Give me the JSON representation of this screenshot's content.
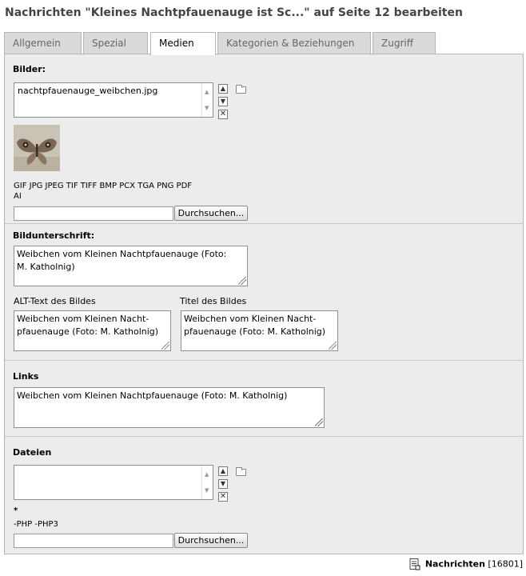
{
  "page": {
    "title": "Nachrichten \"Kleines Nachtpfauenauge ist Sc...\" auf Seite 12 bearbeiten"
  },
  "tabs": [
    {
      "label": "Allgemein"
    },
    {
      "label": "Spezial"
    },
    {
      "label": "Medien"
    },
    {
      "label": "Kategorien & Beziehungen"
    },
    {
      "label": "Zugriff"
    }
  ],
  "active_tab": "Medien",
  "images": {
    "label": "Bilder:",
    "files": [
      "nachtpfauenauge_weibchen.jpg"
    ],
    "allowed_types": "GIF JPG JPEG TIF TIFF BMP PCX TGA PNG PDF",
    "allowed_types_cont": "AI",
    "browse_label": "Durchsuchen..."
  },
  "caption": {
    "label": "Bildunterschrift:",
    "value_line1": "Weibchen vom Kleinen Nachtpfauenauge (Foto:",
    "value_line2": "M. Katholnig)"
  },
  "alt_text": {
    "label": "ALT-Text des Bildes",
    "value_line1": "Weibchen vom Kleinen Nacht-",
    "value_line2": "pfauenauge (Foto: M. Katholnig)"
  },
  "image_title": {
    "label": "Titel des Bildes",
    "value_line1": "Weibchen vom Kleinen Nacht-",
    "value_line2": "pfauenauge (Foto: M. Katholnig)"
  },
  "links": {
    "label": "Links",
    "value": "Weibchen vom Kleinen Nachtpfauenauge (Foto: M. Katholnig)"
  },
  "files": {
    "label": "Dateien",
    "allowed": "*",
    "disallowed": "-PHP -PHP3",
    "browse_label": "Durchsuchen..."
  },
  "footer": {
    "record_label": "Nachrichten",
    "record_id": "[16801]"
  }
}
